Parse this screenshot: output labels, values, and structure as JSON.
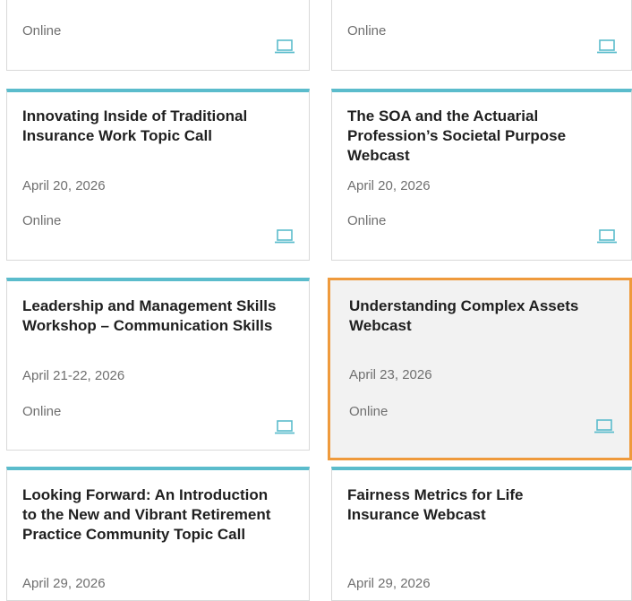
{
  "colors": {
    "accent": "#5bbccc",
    "highlight_border": "#ef9a3c",
    "title_text": "#1f1f1f",
    "meta_text": "#6f6f6f"
  },
  "cards": [
    {
      "title": "",
      "date": "",
      "location": "Online",
      "icon": "laptop-icon"
    },
    {
      "title": "",
      "date": "",
      "location": "Online",
      "icon": "laptop-icon"
    },
    {
      "title": "Innovating Inside of Traditional Insurance Work Topic Call",
      "date": "April 20, 2026",
      "location": "Online",
      "icon": "laptop-icon"
    },
    {
      "title": "The SOA and the Actuarial Profession’s Societal Purpose Webcast",
      "date": "April 20, 2026",
      "location": "Online",
      "icon": "laptop-icon"
    },
    {
      "title": "Leadership and Management Skills Workshop – Communication Skills",
      "date": "April 21-22, 2026",
      "location": "Online",
      "icon": "laptop-icon"
    },
    {
      "title": "Understanding Complex Assets Webcast",
      "date": "April 23, 2026",
      "location": "Online",
      "icon": "laptop-icon",
      "highlighted": true
    },
    {
      "title": "Looking Forward: An Introduction to the New and Vibrant Retirement Practice Community Topic Call",
      "date": "April 29, 2026",
      "location": "",
      "icon": ""
    },
    {
      "title": "Fairness Metrics for Life Insurance Webcast",
      "date": "April 29, 2026",
      "location": "",
      "icon": ""
    }
  ]
}
